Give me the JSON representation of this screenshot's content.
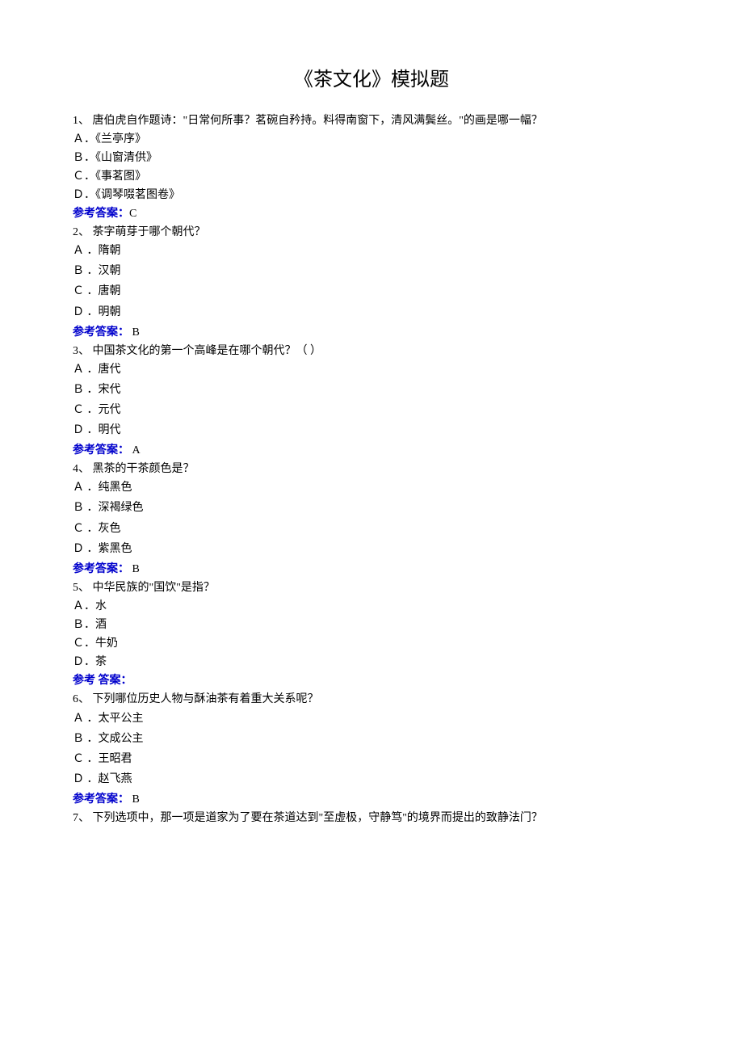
{
  "title": "《茶文化》模拟题",
  "answerLabel": "参考答案：",
  "answerLabelAlt": "参考 答案：",
  "questions": [
    {
      "num": "1、",
      "text": "唐伯虎自作题诗：\"日常何所事？茗碗自矜持。料得南窗下，清风满鬓丝。\"的画是哪一幅？",
      "opts": [
        "Ａ．《兰亭序》",
        "Ｂ．《山窗清供》",
        "Ｃ．《事茗图》",
        "Ｄ．《调琴啜茗图卷》"
      ],
      "answer": "C"
    },
    {
      "num": "2、",
      "text": "茶字萌芽于哪个朝代？",
      "opts": [
        "Ａ ．隋朝",
        "Ｂ ．汉朝",
        "Ｃ ．唐朝",
        "Ｄ ．明朝"
      ],
      "answer": " B"
    },
    {
      "num": "3、",
      "text": "中国茶文化的第一个高峰是在哪个朝代？（ ）",
      "opts": [
        "Ａ ．唐代",
        "Ｂ ．宋代",
        "Ｃ ．元代",
        "Ｄ ．明代"
      ],
      "answer": " A"
    },
    {
      "num": "4、",
      "text": "黑茶的干茶颜色是？",
      "opts": [
        "Ａ ．纯黑色",
        "Ｂ ．深褐绿色",
        "Ｃ ．灰色",
        "Ｄ ．紫黑色"
      ],
      "answer": " B"
    },
    {
      "num": "5、",
      "text": "中华民族的\"国饮\"是指？",
      "opts": [
        "Ａ．水",
        "Ｂ．酒",
        "Ｃ．牛奶",
        "Ｄ．茶"
      ],
      "answer": "",
      "altLabel": true
    },
    {
      "num": "6、",
      "text": "下列哪位历史人物与酥油茶有着重大关系呢？",
      "opts": [
        "Ａ ．太平公主",
        "Ｂ ．文成公主",
        "Ｃ ．王昭君",
        "Ｄ ．赵飞燕"
      ],
      "answer": " B"
    },
    {
      "num": "7、",
      "text": "下列选项中，那一项是道家为了要在茶道达到\"至虚极，守静笃\"的境界而提出的致静法门？",
      "opts": [],
      "answer": null
    }
  ]
}
